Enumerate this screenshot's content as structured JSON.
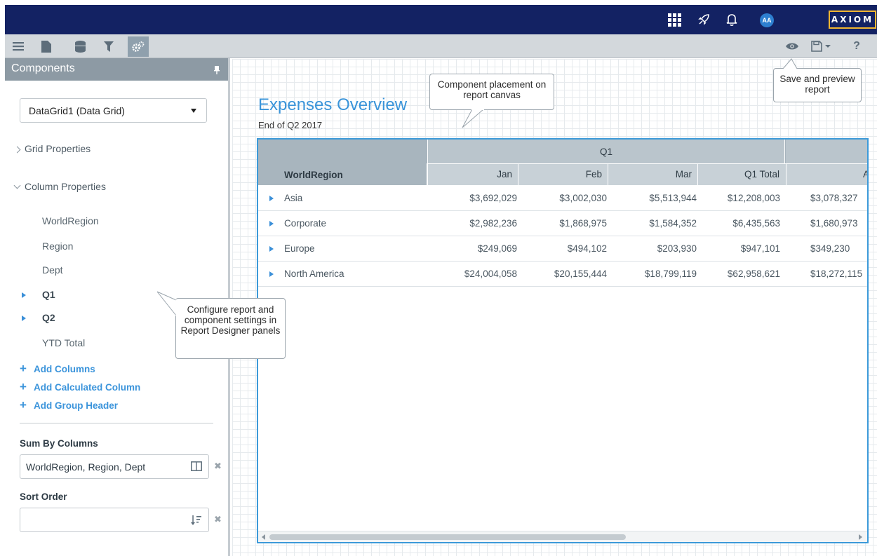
{
  "topnav": {
    "icons": [
      "apps-grid-icon",
      "rocket-icon",
      "bell-icon"
    ],
    "avatar_initials": "AA",
    "brand": "AXIOM"
  },
  "toolbar": {
    "left_icons": [
      "menu-icon",
      "document-icon",
      "database-icon",
      "filter-icon",
      "settings-gears-icon"
    ],
    "active_icon": "settings-gears-icon",
    "right_icons": [
      "preview-eye-icon",
      "save-icon",
      "help-icon"
    ],
    "help_label": "?"
  },
  "sidebar": {
    "title": "Components",
    "component_select": "DataGrid1 (Data Grid)",
    "sections": {
      "grid_properties": "Grid Properties",
      "column_properties": "Column Properties"
    },
    "columns": [
      {
        "label": "WorldRegion",
        "expandable": false
      },
      {
        "label": "Region",
        "expandable": false
      },
      {
        "label": "Dept",
        "expandable": false
      },
      {
        "label": "Q1",
        "expandable": true
      },
      {
        "label": "Q2",
        "expandable": true
      },
      {
        "label": "YTD Total",
        "expandable": false
      }
    ],
    "add_links": [
      "Add Columns",
      "Add Calculated Column",
      "Add Group Header"
    ],
    "sum_by_label": "Sum By Columns",
    "sum_by_value": "WorldRegion, Region, Dept",
    "sort_order_label": "Sort Order",
    "sort_order_value": ""
  },
  "report": {
    "title": "Expenses Overview",
    "subtitle": "End of Q2 2017"
  },
  "grid": {
    "group_header": "Q1",
    "row_header": "WorldRegion",
    "columns": [
      "Jan",
      "Feb",
      "Mar",
      "Q1 Total",
      "Ap"
    ],
    "rows": [
      {
        "name": "Asia",
        "values": [
          "$3,692,029",
          "$3,002,030",
          "$5,513,944",
          "$12,208,003",
          "$3,078,327"
        ]
      },
      {
        "name": "Corporate",
        "values": [
          "$2,982,236",
          "$1,868,975",
          "$1,584,352",
          "$6,435,563",
          "$1,680,973"
        ]
      },
      {
        "name": "Europe",
        "values": [
          "$249,069",
          "$494,102",
          "$203,930",
          "$947,101",
          "$349,230"
        ]
      },
      {
        "name": "North America",
        "values": [
          "$24,004,058",
          "$20,155,444",
          "$18,799,119",
          "$62,958,621",
          "$18,272,115"
        ]
      }
    ],
    "horizontal_scroll_position": 0.0
  },
  "callouts": {
    "canvas": "Component placement on report canvas",
    "save": "Save and preview report",
    "panels": "Configure report and component settings in Report Designer panels"
  },
  "colors": {
    "topnav": "#132263",
    "accent": "#3a94d9",
    "brand_border": "#f2b632"
  }
}
